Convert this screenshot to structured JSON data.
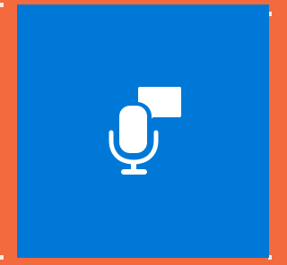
{
  "tile": {
    "icon": "microphone-with-speech-bubble-icon",
    "background_color": "#0078d7",
    "frame_color": "#f26a3d",
    "icon_color": "#ffffff"
  }
}
